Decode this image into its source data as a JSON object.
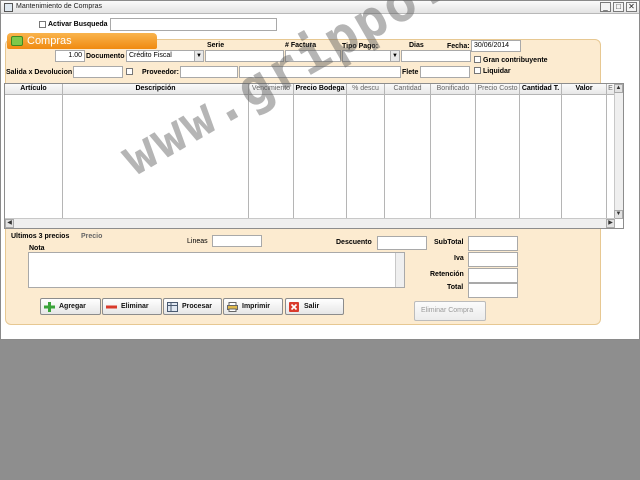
{
  "window": {
    "title": "Mantenimiento de Compras"
  },
  "search": {
    "label": "Activar Busqueda",
    "value": ""
  },
  "tab": {
    "label": "Compras"
  },
  "form": {
    "qty_value": "1.00",
    "documento_label": "Documento",
    "documento_value": "Crédito Fiscal",
    "serie_label": "Serie",
    "serie_value": "",
    "factura_label": "# Factura",
    "factura_value": "",
    "tipo_pago_label": "Tipo Pago:",
    "tipo_pago_value": "",
    "dias_label": "Dias",
    "fecha_label": "Fecha:",
    "fecha_value": "30/06/2014",
    "gran_contribuyente_label": "Gran contribuyente",
    "liquidar_label": "Liquidar",
    "salida_label": "Salida x Devolucion",
    "proveedor_label": "Proveedor:",
    "flete_label": "Flete"
  },
  "grid": {
    "columns": [
      "Artículo",
      "Descripción",
      "Vencimiento",
      "Precio Bodega",
      "% descu",
      "Cantidad",
      "Bonificado",
      "Precio Costo",
      "Cantidad T.",
      "Valor",
      "E"
    ],
    "rows": []
  },
  "footer": {
    "ultimos_label": "Ultimos 3 precios",
    "precio_label": "Precio",
    "lineas_label": "Lineas",
    "nota_label": "Nota",
    "descuento_label": "Descuento",
    "subtotal_label": "SubTotal",
    "iva_label": "Iva",
    "retencion_label": "Retención",
    "total_label": "Total"
  },
  "buttons": {
    "agregar": "Agregar",
    "eliminar": "Eliminar",
    "procesar": "Procesar",
    "imprimir": "Imprimir",
    "salir": "Salir",
    "eliminar_compra": "Eliminar Compra"
  },
  "watermark": "www.grippo.com",
  "colors": {
    "panel": "#fcebd0",
    "tab": "#f08a10",
    "accent_green": "#4caf3a",
    "accent_red": "#d93a2b"
  }
}
